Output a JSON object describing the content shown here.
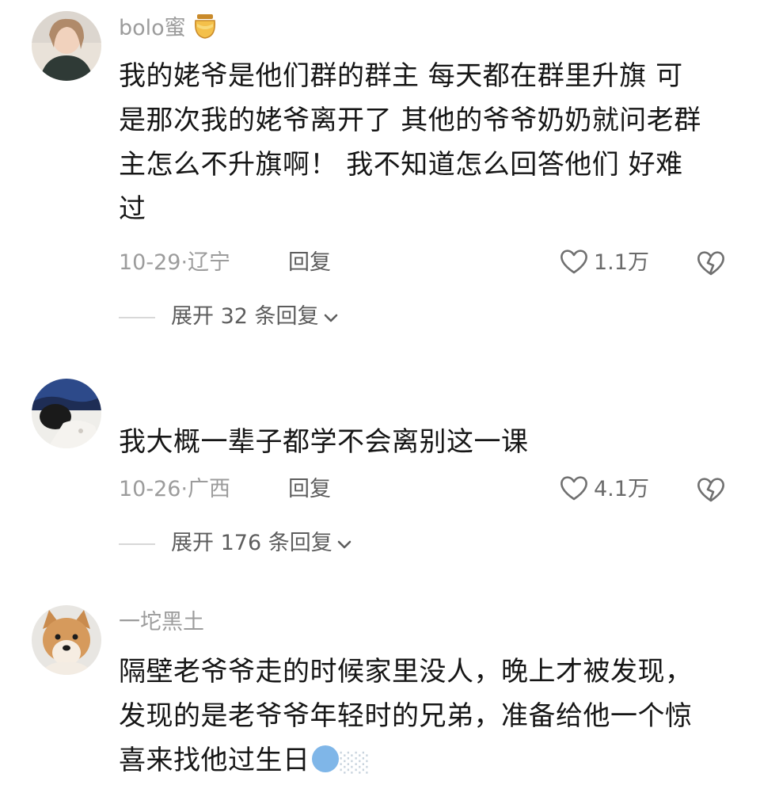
{
  "comments": [
    {
      "username": "bolo蜜",
      "username_icon": "honey-jar-icon",
      "lines": [
        "我的姥爷是他们群的群主 每天都在群里升旗 可",
        "是那次我的姥爷离开了 其他的爷爷奶奶就问老群",
        "主怎么不升旗啊！ 我不知道怎么回答他们 好难",
        "过"
      ],
      "date_location": "10-29·辽宁",
      "reply_label": "回复",
      "likes": "1.1万",
      "expand_label": "展开 32 条回复"
    },
    {
      "username": "",
      "lines": [
        "我大概一辈子都学不会离别这一课"
      ],
      "date_location": "10-26·广西",
      "reply_label": "回复",
      "likes": "4.1万",
      "expand_label": "展开 176 条回复"
    },
    {
      "username": "一坨黑土",
      "lines": [
        "隔壁老爷爷走的时候家里没人，晚上才被发现，",
        "发现的是老爷爷年轻时的兄弟，准备给他一个惊",
        "喜来找他过生日"
      ],
      "trailing_sticker": "blurred-sticker"
    }
  ],
  "colors": {
    "text": "#161616",
    "meta": "#9c9c9c",
    "secondary": "#5d5d5d"
  }
}
